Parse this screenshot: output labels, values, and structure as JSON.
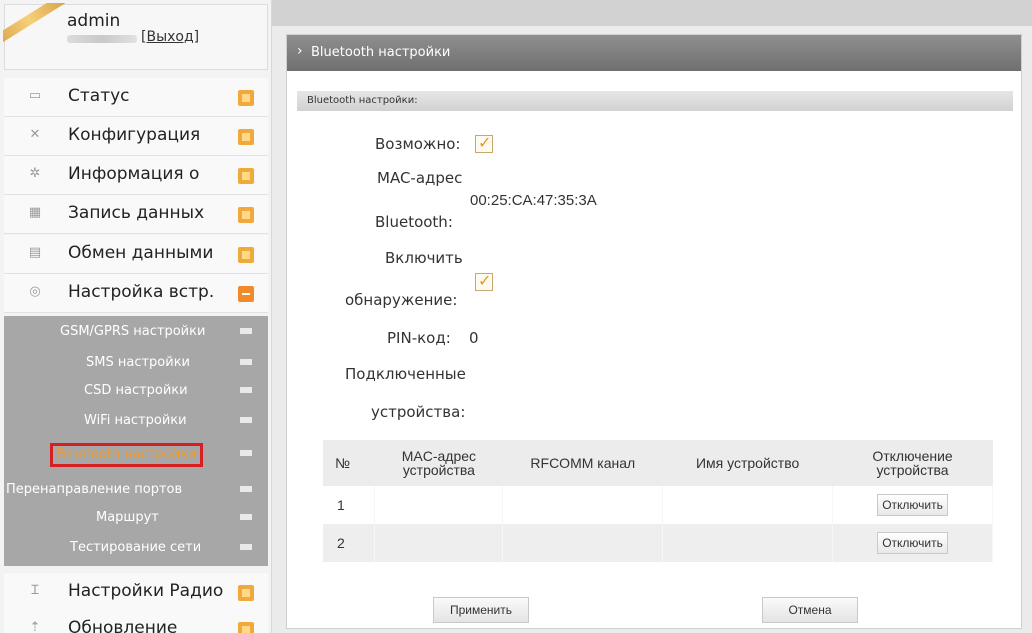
{
  "user": {
    "name": "admin",
    "logout": "Выход",
    "logout_prefix": "[",
    "logout_suffix": "]"
  },
  "sidebar": {
    "items": [
      {
        "label": "Статус",
        "icon": "monitor-icon"
      },
      {
        "label": "Конфигурация",
        "icon": "tools-icon"
      },
      {
        "label": "Информация о",
        "icon": "gear-icon"
      },
      {
        "label": "Запись данных",
        "icon": "calendar-icon"
      },
      {
        "label": "Обмен данными",
        "icon": "document-icon"
      },
      {
        "label": "Настройка встр.",
        "icon": "settings-icon"
      },
      {
        "label": "Настройки Радио",
        "icon": "antenna-icon"
      },
      {
        "label": "Обновление",
        "icon": "upload-icon"
      }
    ],
    "sub_items": [
      {
        "label": "GSM/GPRS настройки"
      },
      {
        "label": "SMS настройки"
      },
      {
        "label": "CSD настройки"
      },
      {
        "label": "WiFi настройки"
      },
      {
        "label": "Bluetooth настройки"
      },
      {
        "label": "Перенаправление портов"
      },
      {
        "label": "Маршрут"
      },
      {
        "label": "Тестирование сети"
      }
    ]
  },
  "page": {
    "title": "Bluetooth настройки",
    "section": "Bluetooth настройки:"
  },
  "form": {
    "enabled_label": "Возможно:",
    "enabled": true,
    "mac_label_1": "MAC-адрес",
    "mac_label_2": "Bluetooth:",
    "mac_value": "00:25:CA:47:35:3A",
    "discover_label_1": "Включить",
    "discover_label_2": "обнаружение:",
    "discoverable": true,
    "pin_label": "PIN-код:",
    "pin_value": "0",
    "connected_label_1": "Подключенные",
    "connected_label_2": "устройства:"
  },
  "devices_table": {
    "headers": [
      "№",
      "MAC-адрес устройства",
      "RFCOMM канал",
      "Имя устройство",
      "Отключение устройства"
    ],
    "rows": [
      {
        "num": "1",
        "mac": "",
        "channel": "",
        "name": "",
        "action": "Отключить"
      },
      {
        "num": "2",
        "mac": "",
        "channel": "",
        "name": "",
        "action": "Отключить"
      }
    ]
  },
  "buttons": {
    "apply": "Применить",
    "cancel": "Отмена"
  }
}
